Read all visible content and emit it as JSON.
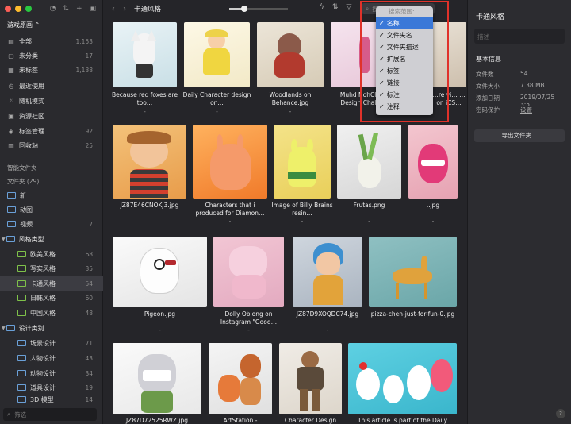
{
  "library": {
    "name": "游戏原画 ⌃"
  },
  "sidebar": {
    "items": [
      {
        "label": "全部",
        "count": "1,153"
      },
      {
        "label": "未分类",
        "count": "17"
      },
      {
        "label": "未标签",
        "count": "1,138"
      },
      {
        "label": "最近使用",
        "count": ""
      },
      {
        "label": "随机模式",
        "count": ""
      },
      {
        "label": "资源社区",
        "count": ""
      },
      {
        "label": "标签管理",
        "count": "92"
      },
      {
        "label": "回收站",
        "count": "25"
      }
    ],
    "smart_folder_header": "智能文件夹",
    "folder_header": "文件夹 (29)",
    "folders": [
      {
        "label": "新",
        "count": ""
      },
      {
        "label": "动图",
        "count": ""
      },
      {
        "label": "视频",
        "count": "7"
      },
      {
        "label": "风格类型",
        "count": ""
      },
      {
        "label": "欧美风格",
        "count": "68"
      },
      {
        "label": "写实风格",
        "count": "35"
      },
      {
        "label": "卡通风格",
        "count": "54"
      },
      {
        "label": "日韩风格",
        "count": "60"
      },
      {
        "label": "中国风格",
        "count": "48"
      },
      {
        "label": "设计类别",
        "count": ""
      },
      {
        "label": "场景设计",
        "count": "71"
      },
      {
        "label": "人物设计",
        "count": "43"
      },
      {
        "label": "动物设计",
        "count": "34"
      },
      {
        "label": "道具设计",
        "count": "19"
      },
      {
        "label": "3D 模型",
        "count": "14"
      }
    ],
    "filter_placeholder": "筛选"
  },
  "toolbar": {
    "title": "卡通风格",
    "zoom": 0.25,
    "search_placeholder": "搜索"
  },
  "search_scope": {
    "header": "搜索范围:",
    "options": [
      {
        "label": "名称",
        "checked": true
      },
      {
        "label": "文件夹名",
        "checked": true
      },
      {
        "label": "文件夹描述",
        "checked": true
      },
      {
        "label": "扩展名",
        "checked": true
      },
      {
        "label": "标签",
        "checked": true
      },
      {
        "label": "链接",
        "checked": true
      },
      {
        "label": "标注",
        "checked": true
      },
      {
        "label": "注释",
        "checked": true
      }
    ]
  },
  "items": [
    {
      "caption": "Because red foxes are too…",
      "sub": "-"
    },
    {
      "caption": "Daily Character design on…",
      "sub": "-"
    },
    {
      "caption": "Woodlands on Behance.jpg",
      "sub": "-"
    },
    {
      "caption": "Muhd NohCha… Design Challe…",
      "sub": "-"
    },
    {
      "caption": "…re vi… …on iCS…",
      "sub": "-"
    },
    {
      "caption": "JZ87E46CNOKJ3.jpg",
      "sub": "-"
    },
    {
      "caption": "Characters that i produced for Diamon…",
      "sub": "-"
    },
    {
      "caption": "Image of Billy Brains resin…",
      "sub": "-"
    },
    {
      "caption": "Frutas.png",
      "sub": "-"
    },
    {
      "caption": "..jpg",
      "sub": "-"
    },
    {
      "caption": "Pigeon.jpg",
      "sub": "-"
    },
    {
      "caption": "Dolly Oblong on Instagram \"Good…",
      "sub": "-"
    },
    {
      "caption": "JZ87D9XOQDC74.jpg",
      "sub": "-"
    },
    {
      "caption": "pizza-chen-just-for-fun-0.jpg",
      "sub": "-"
    },
    {
      "caption": "JZ87D72525RWZ.jpg",
      "sub": ""
    },
    {
      "caption": "ArtStation -",
      "sub": ""
    },
    {
      "caption": "Character Design",
      "sub": ""
    },
    {
      "caption": "This article is part of the Daily",
      "sub": ""
    }
  ],
  "right_panel": {
    "title": "卡通风格",
    "desc_placeholder": "描述",
    "info_header": "基本信息",
    "info": [
      {
        "k": "文件数",
        "v": "54"
      },
      {
        "k": "文件大小",
        "v": "7.38 MB"
      },
      {
        "k": "添加日期",
        "v": "2019/07/25 3:5…"
      },
      {
        "k": "密码保护",
        "v": "设置"
      }
    ],
    "export_label": "导出文件夹…",
    "help": "?"
  }
}
